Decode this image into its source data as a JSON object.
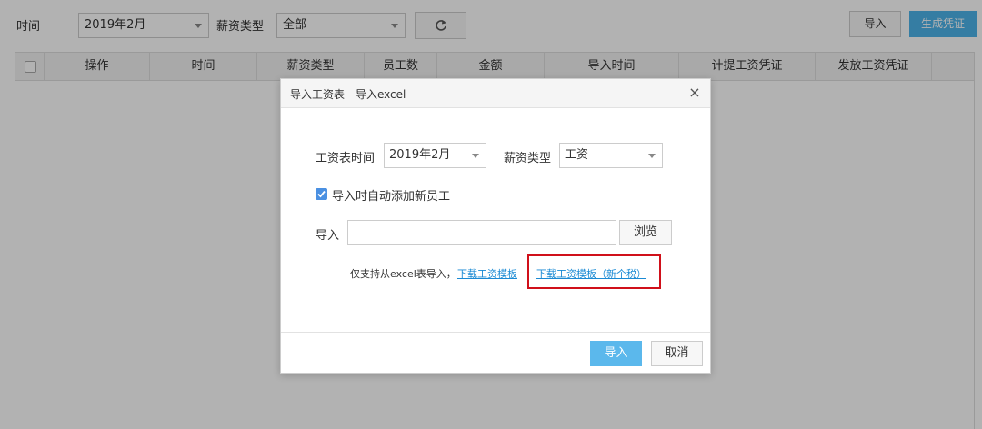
{
  "toolbar": {
    "time_label": "时间",
    "time_value": "2019年2月",
    "salary_type_label": "薪资类型",
    "salary_type_value": "全部",
    "import_label": "导入",
    "generate_label": "生成凭证"
  },
  "table": {
    "columns": [
      "操作",
      "时间",
      "薪资类型",
      "员工数",
      "金额",
      "导入时间",
      "计提工资凭证",
      "发放工资凭证"
    ]
  },
  "modal": {
    "title": "导入工资表 - 导入excel",
    "close": "×",
    "payroll_time_label": "工资表时间",
    "payroll_time_value": "2019年2月",
    "salary_type_label": "薪资类型",
    "salary_type_value": "工资",
    "auto_add_label": "导入时自动添加新员工",
    "import_label": "导入",
    "file_value": "",
    "browse_label": "浏览",
    "note": "仅支持从excel表导入，",
    "download_template": "下载工资模板",
    "download_template_new": "下载工资模板（新个税）",
    "confirm_label": "导入",
    "cancel_label": "取消"
  },
  "colors": {
    "primary": "#4db3ea",
    "link": "#1a8ad4",
    "highlight": "#d0101a"
  }
}
